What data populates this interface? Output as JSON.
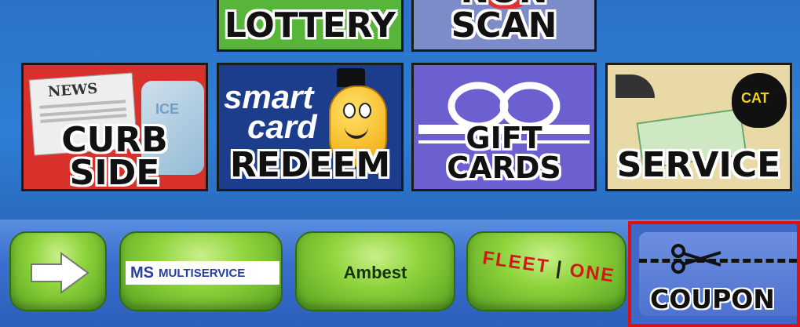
{
  "tiles": {
    "lottery": "LOTTERY",
    "nonscan": "NON SCAN",
    "curbside_line1": "CURB",
    "curbside_line2": "SIDE",
    "curbside_news": "NEWS",
    "curbside_ice": "ICE",
    "redeem_smart": "smart",
    "redeem_card": "card",
    "redeem": "REDEEM",
    "giftcards": "GIFT CARDS",
    "service": "SERVICE",
    "service_cat": "CAT"
  },
  "bottom": {
    "multiservice": "MULTISERVICE",
    "multiservice_logo": "MS",
    "ambest": "Ambest",
    "fleetone_left": "FLEET",
    "fleetone_right": "ONE",
    "coupon": "COUPON"
  },
  "colors": {
    "highlight": "#e01010",
    "green_button": "#8fd43c",
    "background_blue": "#2f7ed6"
  }
}
